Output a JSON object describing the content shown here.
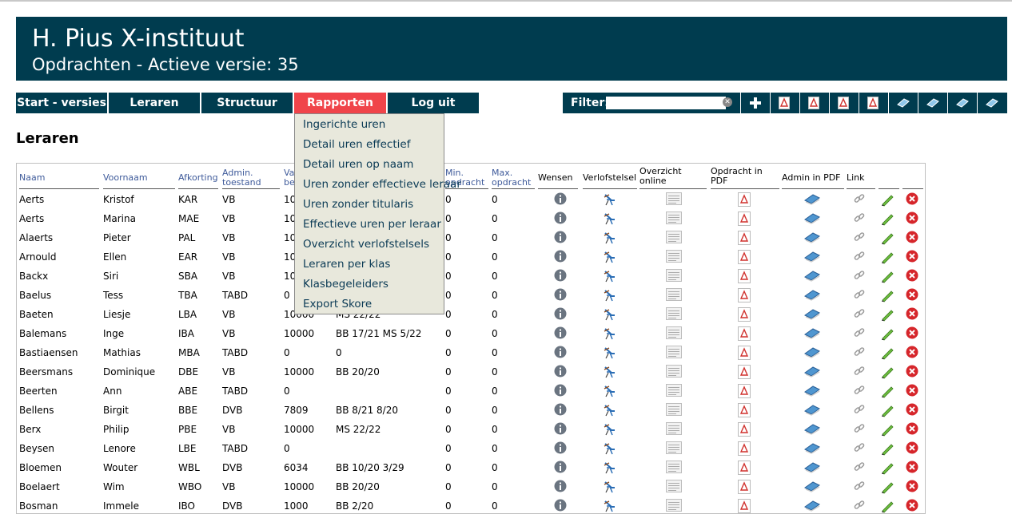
{
  "header": {
    "title": "H. Pius X-instituut",
    "subtitle": "Opdrachten - Actieve versie: 35"
  },
  "nav": {
    "items": [
      "Start - versies",
      "Leraren",
      "Structuur",
      "Rapporten",
      "Log uit"
    ],
    "active": "Rapporten"
  },
  "toolbar": {
    "filter_label": "Filter:",
    "filter_value": "",
    "buttons": [
      "add-icon",
      "pdf-icon",
      "pdf-icon",
      "pdf-icon",
      "pdf-icon",
      "eraser-icon",
      "eraser-icon",
      "eraser-icon",
      "eraser-icon"
    ]
  },
  "page_title": "Leraren",
  "dropdown": {
    "items": [
      "Ingerichte uren",
      "Detail uren effectief",
      "Detail uren op naam",
      "Uren zonder effectieve leraar",
      "Uren zonder titularis",
      "Effectieve uren per leraar",
      "Overzicht verlofstelsels",
      "Leraren per klas",
      "Klasbegeleiders",
      "Export Skore"
    ]
  },
  "table": {
    "headers": {
      "naam": "Naam",
      "voornaam": "Voornaam",
      "afkorting": "Afkorting",
      "admin_toestand": [
        "Admin.",
        "toestand"
      ],
      "va": [
        "Va",
        "be"
      ],
      "min": [
        "Min.",
        "opdracht"
      ],
      "max": [
        "Max.",
        "opdracht"
      ],
      "wensen": "Wensen",
      "verlofstelsel": "Verlofstelsel",
      "overzicht": [
        "Overzicht",
        "online"
      ],
      "opdracht_pdf": [
        "Opdracht in",
        "PDF"
      ],
      "admin_pdf": "Admin in PDF",
      "link": "Link"
    },
    "rows": [
      [
        "Aerts",
        "Kristof",
        "KAR",
        "VB",
        "10",
        "",
        "0",
        "0"
      ],
      [
        "Aerts",
        "Marina",
        "MAE",
        "VB",
        "10",
        "",
        "0",
        "0"
      ],
      [
        "Alaerts",
        "Pieter",
        "PAL",
        "VB",
        "10",
        "",
        "0",
        "0"
      ],
      [
        "Arnould",
        "Ellen",
        "EAR",
        "VB",
        "10",
        "",
        "0",
        "0"
      ],
      [
        "Backx",
        "Siri",
        "SBA",
        "VB",
        "10",
        "",
        "0",
        "0"
      ],
      [
        "Baelus",
        "Tess",
        "TBA",
        "TABD",
        "0",
        "",
        "0",
        "0"
      ],
      [
        "Baeten",
        "Liesje",
        "LBA",
        "VB",
        "10000",
        "MS 22/22",
        "0",
        "0"
      ],
      [
        "Balemans",
        "Inge",
        "IBA",
        "VB",
        "10000",
        "BB 17/21 MS 5/22",
        "0",
        "0"
      ],
      [
        "Bastiaensen",
        "Mathias",
        "MBA",
        "TABD",
        "0",
        "0",
        "0",
        "0"
      ],
      [
        "Beersmans",
        "Dominique",
        "DBE",
        "VB",
        "10000",
        "BB 20/20",
        "0",
        "0"
      ],
      [
        "Beerten",
        "Ann",
        "ABE",
        "TABD",
        "0",
        "",
        "0",
        "0"
      ],
      [
        "Bellens",
        "Birgit",
        "BBE",
        "DVB",
        "7809",
        "BB 8/21 8/20",
        "0",
        "0"
      ],
      [
        "Berx",
        "Philip",
        "PBE",
        "VB",
        "10000",
        "MS 22/22",
        "0",
        "0"
      ],
      [
        "Beysen",
        "Lenore",
        "LBE",
        "TABD",
        "0",
        "",
        "0",
        "0"
      ],
      [
        "Bloemen",
        "Wouter",
        "WBL",
        "DVB",
        "6034",
        "BB 10/20 3/29",
        "0",
        "0"
      ],
      [
        "Boelaert",
        "Wim",
        "WBO",
        "VB",
        "10000",
        "BB 20/20",
        "0",
        "0"
      ],
      [
        "Bosman",
        "Immele",
        "IBO",
        "DVB",
        "1000",
        "BB 2/20",
        "0",
        "0"
      ]
    ]
  },
  "colors": {
    "header_bg": "#003c4f",
    "active_tab": "#f0444a",
    "dropdown_bg": "#e8e8dc",
    "link_text": "#3e5a9a"
  }
}
